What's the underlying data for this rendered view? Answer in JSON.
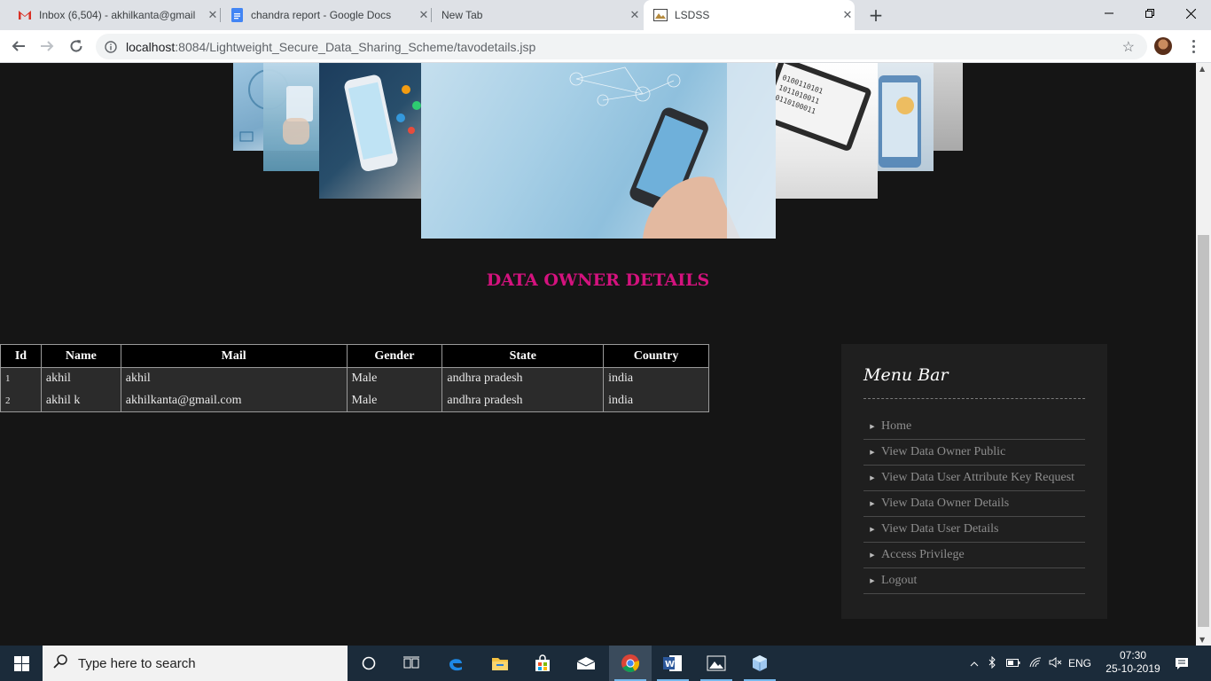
{
  "browser": {
    "tabs": [
      {
        "title": "Inbox (6,504) - akhilkanta@gmail",
        "icon": "gmail-icon"
      },
      {
        "title": "chandra report - Google Docs",
        "icon": "docs-icon"
      },
      {
        "title": "New Tab",
        "icon": ""
      },
      {
        "title": "LSDSS",
        "icon": "site-icon"
      }
    ],
    "url_host": "localhost",
    "url_path": ":8084/Lightweight_Secure_Data_Sharing_Scheme/tavodetails.jsp"
  },
  "page": {
    "title": "DATA OWNER DETAILS",
    "table": {
      "headers": [
        "Id",
        "Name",
        "Mail",
        "Gender",
        "State",
        "Country"
      ],
      "rows": [
        [
          "1",
          "akhil",
          "akhil",
          "Male",
          "andhra pradesh",
          "india"
        ],
        [
          "2",
          "akhil k",
          "akhilkanta@gmail.com",
          "Male",
          "andhra pradesh",
          "india"
        ]
      ]
    },
    "menu": {
      "title": "Menu Bar",
      "items": [
        "Home",
        "View Data Owner Public",
        "View Data User Attribute Key Request",
        "View Data Owner Details",
        "View Data User Details",
        "Access Privilege",
        "Logout"
      ]
    }
  },
  "taskbar": {
    "search_placeholder": "Type here to search",
    "language": "ENG",
    "time": "07:30",
    "date": "25-10-2019"
  },
  "colors": {
    "title_accent": "#d4127e",
    "page_bg": "#151515",
    "menu_bg": "#1f1f1f"
  }
}
